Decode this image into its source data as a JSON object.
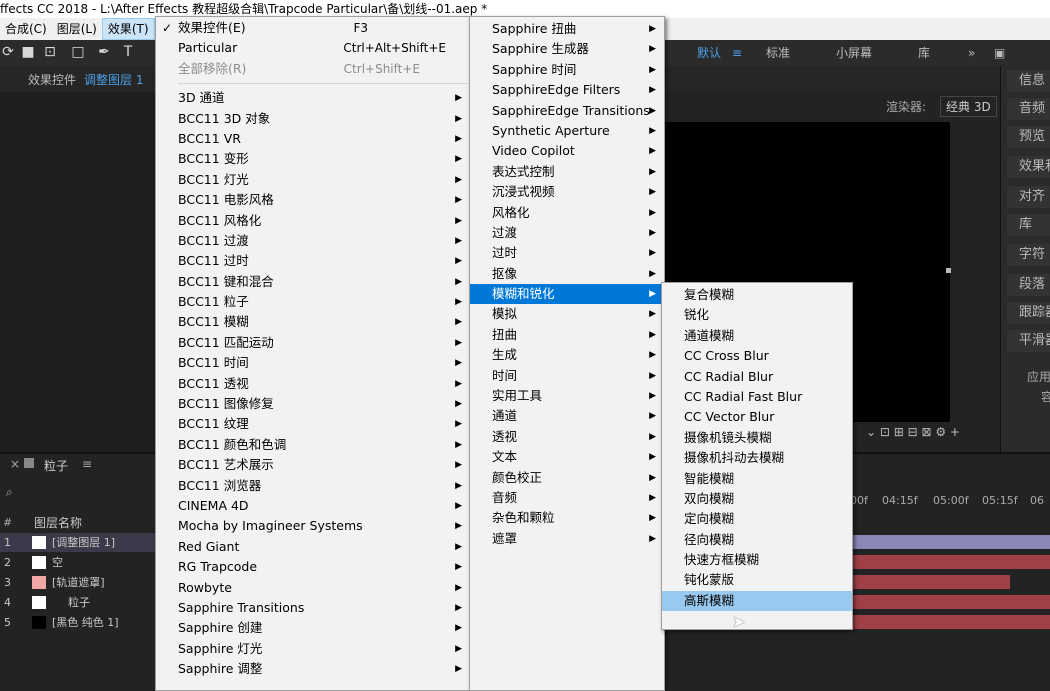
{
  "title": "ffects CC 2018 - L:\\After Effects 教程超级合辑\\Trapcode Particular\\备\\划线--01.aep *",
  "menubar": [
    "合成(C)",
    "图层(L)",
    "效果(T)"
  ],
  "workspace_tabs": [
    "默认",
    "标准",
    "小屏幕",
    "库"
  ],
  "panel_header": {
    "effects_label": "效果控件",
    "layer_name": "调整图层 1",
    "renderer_label": "渲染器:",
    "renderer_value": "经典 3D"
  },
  "right_panel": [
    "信息",
    "音频",
    "预览",
    "效果和",
    "对齐",
    "库",
    "字符",
    "段落",
    "跟踪器",
    "平滑器",
    "应用",
    "容"
  ],
  "timeline": {
    "tab": "粒子",
    "col_header_num": "#",
    "col_header_name": "图层名称",
    "time_ticks": [
      "00f",
      "04:15f",
      "05:00f",
      "05:15f",
      "06"
    ],
    "layers": [
      {
        "num": "1",
        "name": "[调整图层 1]",
        "swatch": "#ffffff"
      },
      {
        "num": "2",
        "name": "空",
        "swatch": "#ffffff"
      },
      {
        "num": "3",
        "name": "[轨道遮罩]",
        "swatch": "#f2a6a6"
      },
      {
        "num": "4",
        "name": "粒子",
        "swatch": "#ffffff"
      },
      {
        "num": "5",
        "name": "[黑色 纯色 1]",
        "swatch": "#000000"
      }
    ]
  },
  "menu1": {
    "top_items": [
      {
        "label": "效果控件(E)",
        "shortcut": "F3",
        "checked": true
      },
      {
        "label": "Particular",
        "shortcut": "Ctrl+Alt+Shift+E"
      },
      {
        "label": "全部移除(R)",
        "shortcut": "Ctrl+Shift+E",
        "disabled": true
      }
    ],
    "items": [
      "3D 通道",
      "BCC11 3D 对象",
      "BCC11 VR",
      "BCC11 变形",
      "BCC11 灯光",
      "BCC11 电影风格",
      "BCC11 风格化",
      "BCC11 过渡",
      "BCC11 过时",
      "BCC11 键和混合",
      "BCC11 粒子",
      "BCC11 模糊",
      "BCC11 匹配运动",
      "BCC11 时间",
      "BCC11 透视",
      "BCC11 图像修复",
      "BCC11 纹理",
      "BCC11 颜色和色调",
      "BCC11 艺术展示",
      "BCC11 浏览器",
      "CINEMA 4D",
      "Mocha by Imagineer Systems",
      "Red Giant",
      "RG Trapcode",
      "Rowbyte",
      "Sapphire Transitions",
      "Sapphire 创建",
      "Sapphire 灯光",
      "Sapphire 调整"
    ]
  },
  "menu2": {
    "items": [
      "Sapphire 扭曲",
      "Sapphire 生成器",
      "Sapphire 时间",
      "SapphireEdge Filters",
      "SapphireEdge Transitions",
      "Synthetic Aperture",
      "Video Copilot",
      "表达式控制",
      "沉浸式视频",
      "风格化",
      "过渡",
      "过时",
      "抠像",
      "模糊和锐化",
      "模拟",
      "扭曲",
      "生成",
      "时间",
      "实用工具",
      "通道",
      "透视",
      "文本",
      "颜色校正",
      "音频",
      "杂色和颗粒",
      "遮罩"
    ],
    "highlighted": "模糊和锐化"
  },
  "menu3": {
    "items": [
      "复合模糊",
      "锐化",
      "通道模糊",
      "CC Cross Blur",
      "CC Radial Blur",
      "CC Radial Fast Blur",
      "CC Vector Blur",
      "摄像机镜头模糊",
      "摄像机抖动去模糊",
      "智能模糊",
      "双向模糊",
      "定向模糊",
      "径向模糊",
      "快速方框模糊",
      "钝化蒙版",
      "高斯模糊"
    ],
    "highlighted": "高斯模糊"
  }
}
